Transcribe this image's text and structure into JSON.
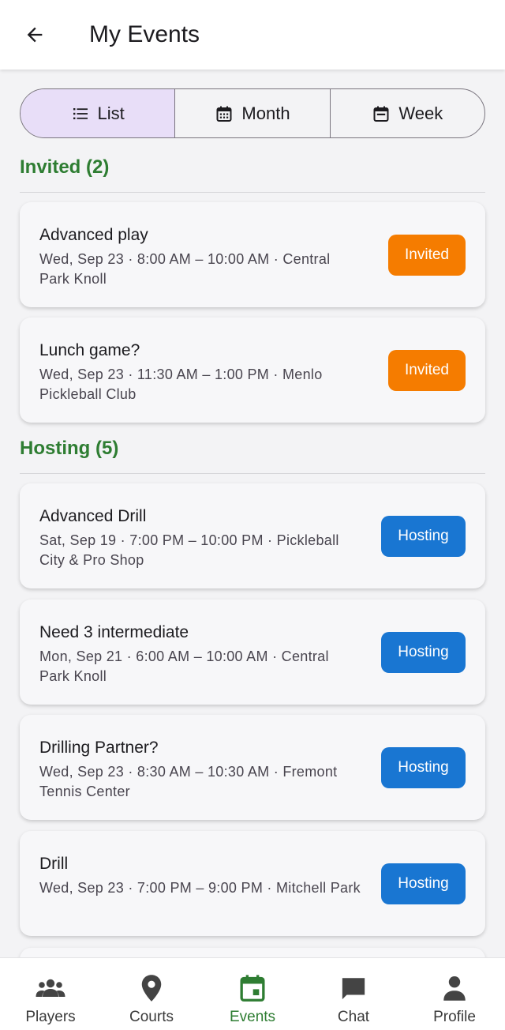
{
  "header": {
    "title": "My Events"
  },
  "view_toggle": {
    "selected": "List",
    "options": [
      {
        "label": "List",
        "icon": "list-icon"
      },
      {
        "label": "Month",
        "icon": "calendar-month-icon"
      },
      {
        "label": "Week",
        "icon": "calendar-week-icon"
      }
    ]
  },
  "sections": [
    {
      "title": "Invited (2)",
      "events": [
        {
          "title": "Advanced play",
          "details": "Wed, Sep 23 · 8:00 AM – 10:00 AM · Central Park Knoll",
          "status": "Invited"
        },
        {
          "title": "Lunch game?",
          "details": "Wed, Sep 23 · 11:30 AM – 1:00 PM · Menlo Pickleball Club",
          "status": "Invited"
        }
      ]
    },
    {
      "title": "Hosting (5)",
      "events": [
        {
          "title": "Advanced Drill",
          "details": "Sat, Sep 19 · 7:00 PM – 10:00 PM · Pickleball City & Pro Shop",
          "status": "Hosting"
        },
        {
          "title": "Need 3 intermediate",
          "details": "Mon, Sep 21 · 6:00 AM – 10:00 AM · Central Park Knoll",
          "status": "Hosting"
        },
        {
          "title": "Drilling Partner?",
          "details": "Wed, Sep 23 · 8:30 AM – 10:30 AM · Fremont Tennis Center",
          "status": "Hosting"
        },
        {
          "title": "Drill",
          "details": "Wed, Sep 23 · 7:00 PM – 9:00 PM · Mitchell Park",
          "status": "Hosting"
        }
      ]
    }
  ],
  "colors": {
    "invited": "#f57c00",
    "hosting": "#1976d2",
    "section": "#2e7d32",
    "selected_segment": "#e8def8"
  },
  "bottom_nav": {
    "active": "Events",
    "items": [
      {
        "label": "Players",
        "icon": "people-icon"
      },
      {
        "label": "Courts",
        "icon": "location-pin-icon"
      },
      {
        "label": "Events",
        "icon": "event-icon"
      },
      {
        "label": "Chat",
        "icon": "chat-icon"
      },
      {
        "label": "Profile",
        "icon": "person-icon"
      }
    ]
  }
}
